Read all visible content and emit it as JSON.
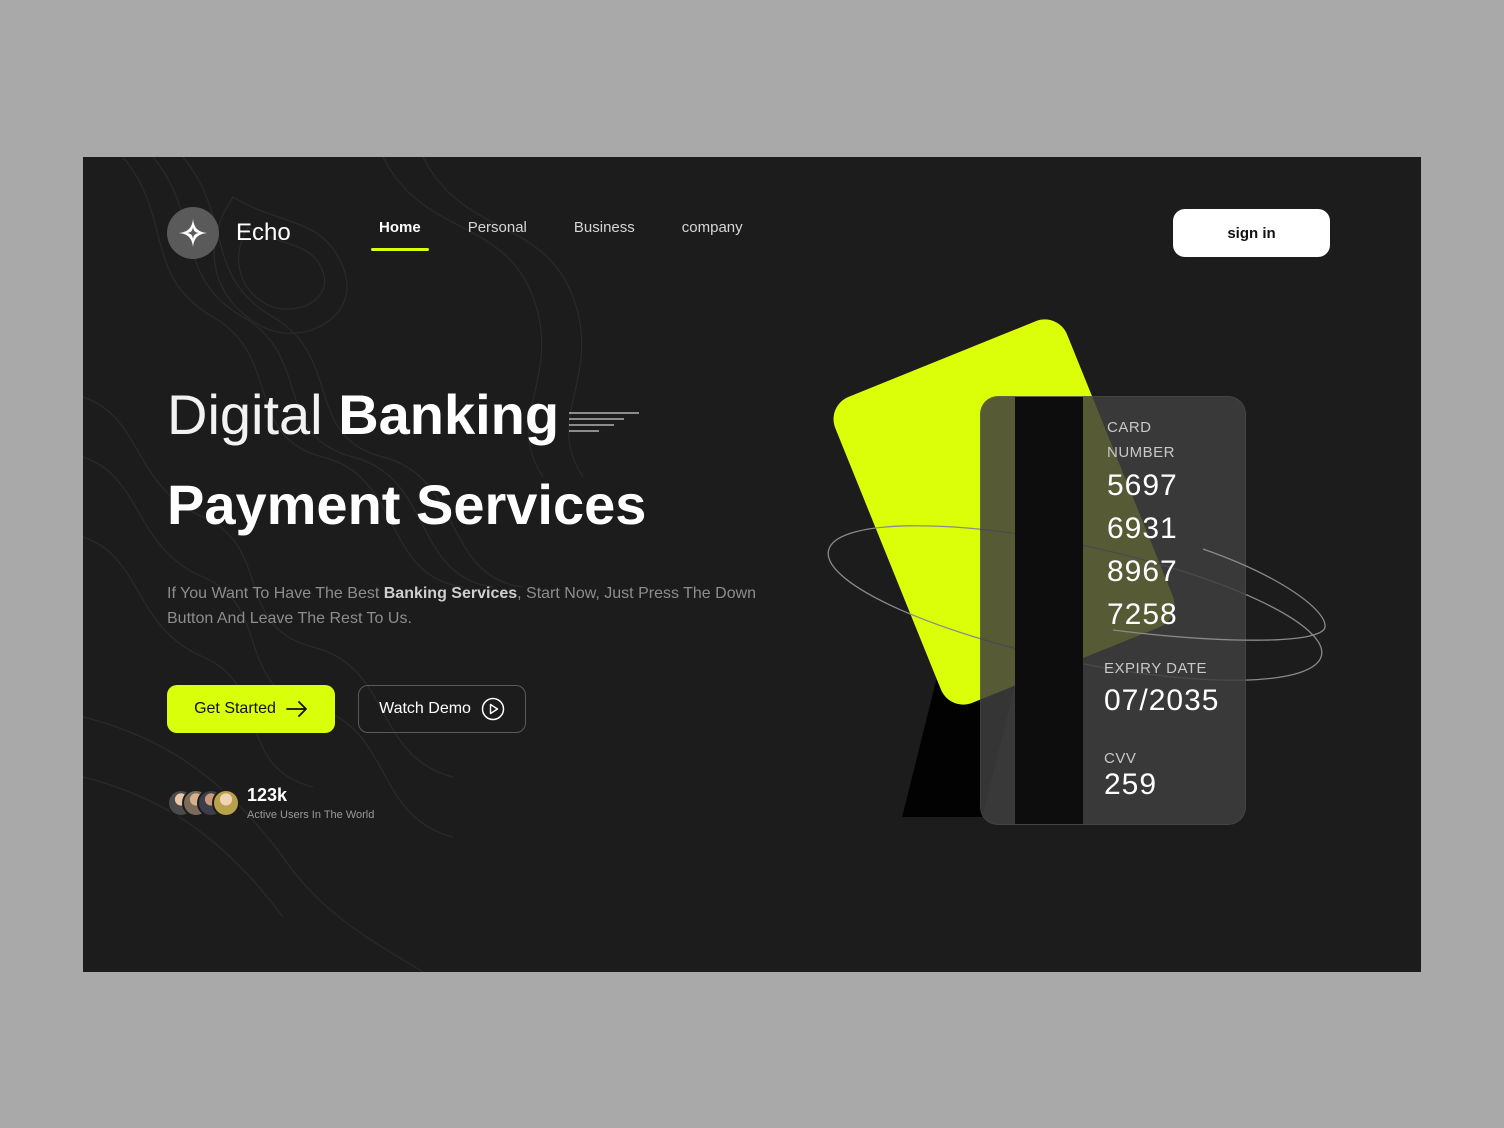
{
  "brand": {
    "name": "Echo",
    "logo_icon": "sparkle-star-icon"
  },
  "nav": {
    "items": [
      {
        "label": "Home",
        "active": true
      },
      {
        "label": "Personal",
        "active": false
      },
      {
        "label": "Business",
        "active": false
      },
      {
        "label": "company",
        "active": false
      }
    ]
  },
  "header": {
    "signin_label": "sign in"
  },
  "hero": {
    "title_light": "Digital",
    "title_bold": "Banking",
    "title_line2": "Payment Services",
    "desc_part1": "If You Want To Have The Best ",
    "desc_bold": "Banking Services",
    "desc_part2": ", Start Now, Just Press The Down Button And Leave The Rest To Us.",
    "cta_primary": "Get Started",
    "cta_secondary": "Watch Demo"
  },
  "users": {
    "count": "123k",
    "label": "Active Users In The World"
  },
  "card": {
    "number_label_1": "CARD",
    "number_label_2": "NUMBER",
    "number_groups": [
      "5697",
      "6931",
      "8967",
      "7258"
    ],
    "expiry_label": "EXPIRY DATE",
    "expiry": "07/2035",
    "cvv_label": "CVV",
    "cvv": "259"
  },
  "colors": {
    "accent": "#d9ff0a",
    "background": "#1c1c1c",
    "page_background": "#a9a9a9",
    "card_front": "#3e3e3e",
    "text_muted": "#8d8d8d"
  }
}
